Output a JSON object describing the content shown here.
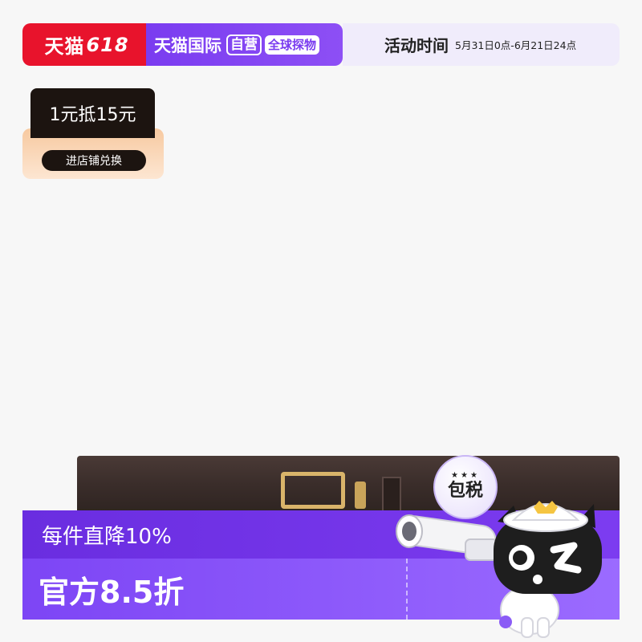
{
  "banner": {
    "tmall_text": "天猫",
    "tmall_618": "618",
    "global_text": "天猫国际",
    "self_tag": "自营",
    "global_tag": "全球探物",
    "activity_label": "活动时间",
    "activity_dates": "5月31日0点-6月21日24点"
  },
  "coupon": {
    "value": "1元抵15元",
    "button": "进店铺兑换"
  },
  "badge": {
    "stars": "★★★",
    "text": "包税"
  },
  "promo": {
    "line1": "每件直降10%",
    "line2": "官方8.5折"
  },
  "colors": {
    "tmall_red": "#e8132c",
    "brand_purple": "#7a3cf0",
    "coupon_dark": "#1c1410",
    "belt_brown": "#3a2d2a",
    "buckle_gold": "#d9b46a"
  }
}
